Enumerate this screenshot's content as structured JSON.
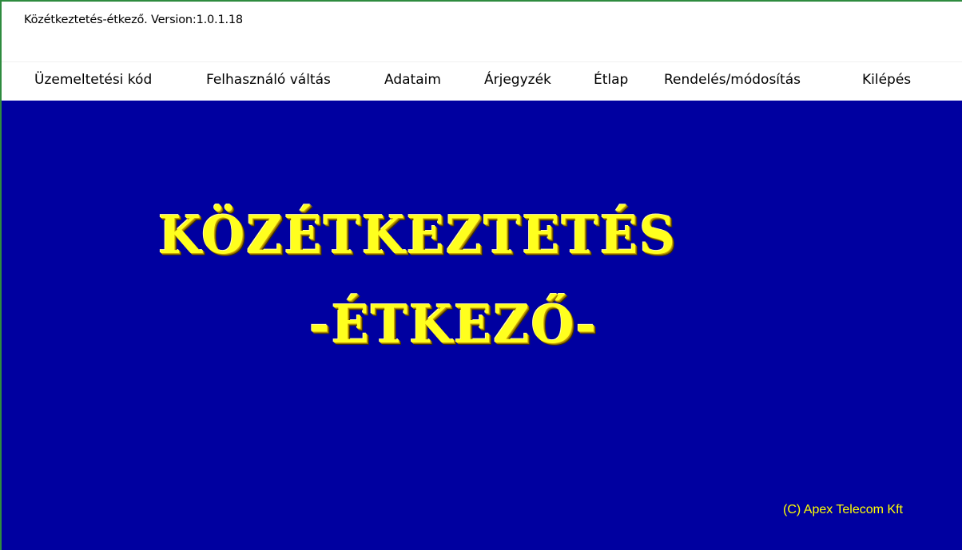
{
  "window": {
    "title": "Közétkeztetés-étkező.  Version:1.0.1.18"
  },
  "menu": {
    "items": [
      {
        "label": "Üzemeltetési kód"
      },
      {
        "label": "Felhasználó váltás"
      },
      {
        "label": "Adataim"
      },
      {
        "label": "Árjegyzék"
      },
      {
        "label": "Étlap"
      },
      {
        "label": "Rendelés/módosítás"
      },
      {
        "label": "Kilépés"
      }
    ]
  },
  "banner": {
    "line1": "KÖZÉTKEZTETÉS",
    "line2": "-ÉTKEZŐ-"
  },
  "footer": {
    "copyright": "(C) Apex Telecom Kft"
  },
  "colors": {
    "background": "#0000a0",
    "banner_text": "#ffff1e",
    "window_border": "#2e8b3f"
  }
}
